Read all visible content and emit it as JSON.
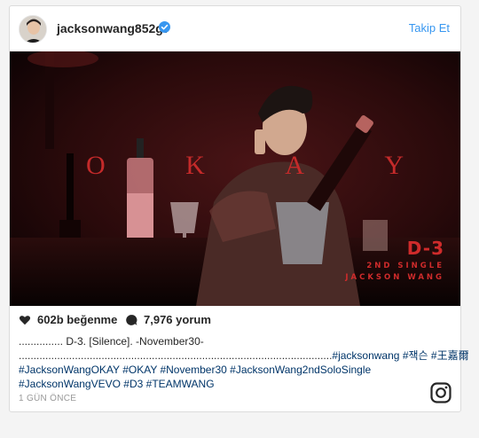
{
  "post": {
    "username": "jacksonwang852g7",
    "follow_label": "Takip Et",
    "photo": {
      "overlay_word": [
        "O",
        "K",
        "A",
        "Y"
      ],
      "badge_main": "D-3",
      "badge_line1": "2ND SINGLE",
      "badge_line2": "JACKSON WANG"
    },
    "likes": "602b beğenme",
    "comments": "7,976 yorum",
    "caption": {
      "line1": "............... D-3. [Silence]. -November30-",
      "line2_dots": "..........................................................................................................",
      "line2_tags": [
        "#jacksonwang",
        "#잭슨",
        "#王嘉爾"
      ],
      "line3_tags": [
        "#JacksonWangOKAY",
        "#OKAY",
        "#November30",
        "#JacksonWang2ndSoloSingle"
      ],
      "line4_tags": [
        "#JacksonWangVEVO",
        "#D3",
        "#TEAMWANG"
      ]
    },
    "timestamp": "1 GÜN ÖNCE",
    "colors": {
      "link": "#3897f0",
      "hashtag": "#003569",
      "verified": "#3897f0",
      "photo_accent": "#c42a2a"
    },
    "icons": [
      "verified-badge-icon",
      "heart-icon",
      "comment-icon",
      "instagram-icon"
    ]
  }
}
